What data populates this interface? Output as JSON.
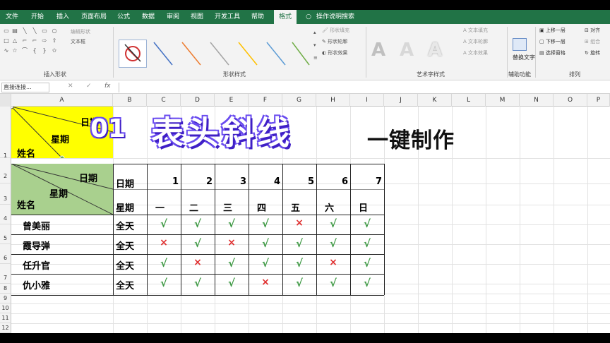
{
  "ribbon": {
    "tabs": [
      "文件",
      "开始",
      "插入",
      "页面布局",
      "公式",
      "数据",
      "审阅",
      "视图",
      "开发工具",
      "帮助",
      "格式"
    ],
    "active_tab": "格式",
    "search_placeholder": "操作说明搜索",
    "groups": {
      "insert_shapes": "插入形状",
      "shape_styles": "形状样式",
      "wordart_styles": "艺术字样式",
      "accessibility": "辅助功能",
      "arrange": "排列"
    },
    "insert_shapes_items": {
      "edit_shape": "编辑形状",
      "text_box": "文本框"
    },
    "shape_style_items": {
      "fill": "形状填充",
      "outline": "形状轮廓",
      "effects": "形状效果"
    },
    "wordart_items": {
      "text_fill": "文本填充",
      "text_outline": "文本轮廓",
      "text_effects": "文本效果"
    },
    "accessibility_items": {
      "alt_text": "替换文字"
    },
    "arrange_items": {
      "bring_forward": "上移一层",
      "send_backward": "下移一层",
      "selection_pane": "选择窗格",
      "align": "对齐",
      "group": "组合",
      "rotate": "旋转"
    }
  },
  "formula_bar": {
    "name_box": "直接连接...",
    "fx": "fx"
  },
  "columns": [
    "A",
    "B",
    "C",
    "D",
    "E",
    "F",
    "G",
    "H",
    "I",
    "J",
    "K",
    "L",
    "M",
    "N",
    "O",
    "P"
  ],
  "rows": [
    "1",
    "2",
    "3",
    "4",
    "5",
    "6",
    "7",
    "8",
    "9",
    "10",
    "11",
    "12"
  ],
  "title": {
    "num": "01",
    "main": "表头斜线",
    "sub": "一键制作"
  },
  "header_a1": {
    "date": "日期",
    "week": "星期",
    "name": "姓名"
  },
  "header_a23": {
    "date": "日期",
    "week": "星期",
    "name": "姓名"
  },
  "table": {
    "row2_label": "日期",
    "row3_label": "星期",
    "days": [
      "1",
      "2",
      "3",
      "4",
      "5",
      "6",
      "7"
    ],
    "weekdays": [
      "一",
      "二",
      "三",
      "四",
      "五",
      "六",
      "日"
    ],
    "people": [
      {
        "name": "曾美丽",
        "type": "全天",
        "marks": [
          "√",
          "√",
          "√",
          "√",
          "×",
          "√",
          "√"
        ]
      },
      {
        "name": "霞导弹",
        "type": "全天",
        "marks": [
          "×",
          "√",
          "×",
          "√",
          "√",
          "√",
          "√"
        ]
      },
      {
        "name": "任升官",
        "type": "全天",
        "marks": [
          "√",
          "×",
          "√",
          "√",
          "√",
          "×",
          "√"
        ]
      },
      {
        "name": "仇小雅",
        "type": "全天",
        "marks": [
          "√",
          "√",
          "√",
          "×",
          "√",
          "√",
          "√"
        ]
      }
    ]
  },
  "colors": {
    "ribbon_green": "#217346",
    "yellow": "#FFFF00",
    "header_green": "#A9D08E",
    "check": "#3F9A45",
    "cross": "#E03030"
  }
}
